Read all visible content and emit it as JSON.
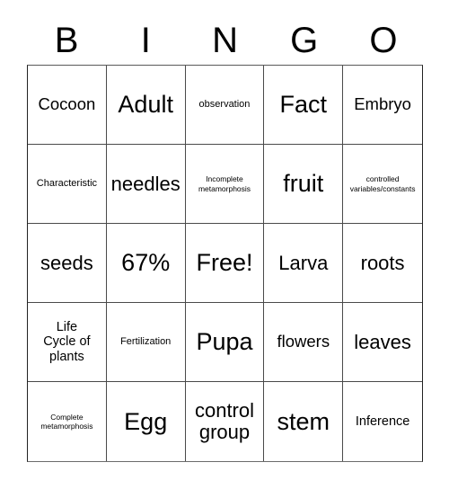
{
  "card": {
    "header_letters": [
      "B",
      "I",
      "N",
      "G",
      "O"
    ],
    "rows": [
      [
        {
          "text": "Cocoon",
          "size": "sz-lg"
        },
        {
          "text": "Adult",
          "size": "sz-xxl"
        },
        {
          "text": "observation",
          "size": "sz-sm"
        },
        {
          "text": "Fact",
          "size": "sz-xxl"
        },
        {
          "text": "Embryo",
          "size": "sz-lg"
        }
      ],
      [
        {
          "text": "Characteristic",
          "size": "sz-sm"
        },
        {
          "text": "needles",
          "size": "sz-xl"
        },
        {
          "text": "Incomplete\nmetamorphosis",
          "size": "sz-xs"
        },
        {
          "text": "fruit",
          "size": "sz-xxl"
        },
        {
          "text": "controlled\nvariables/constants",
          "size": "sz-xs"
        }
      ],
      [
        {
          "text": "seeds",
          "size": "sz-xl"
        },
        {
          "text": "67%",
          "size": "sz-xxl"
        },
        {
          "text": "Free!",
          "size": "sz-xxl"
        },
        {
          "text": "Larva",
          "size": "sz-xl"
        },
        {
          "text": "roots",
          "size": "sz-xl"
        }
      ],
      [
        {
          "text": "Life\nCycle of\nplants",
          "size": "sz-md"
        },
        {
          "text": "Fertilization",
          "size": "sz-sm"
        },
        {
          "text": "Pupa",
          "size": "sz-xxl"
        },
        {
          "text": "flowers",
          "size": "sz-lg"
        },
        {
          "text": "leaves",
          "size": "sz-xl"
        }
      ],
      [
        {
          "text": "Complete\nmetamorphosis",
          "size": "sz-xs"
        },
        {
          "text": "Egg",
          "size": "sz-xxl"
        },
        {
          "text": "control\ngroup",
          "size": "sz-xl"
        },
        {
          "text": "stem",
          "size": "sz-xxl"
        },
        {
          "text": "Inference",
          "size": "sz-md"
        }
      ]
    ]
  },
  "colors": {
    "background": "#ffffff",
    "text": "#000000",
    "grid_line": "#4a4a4a",
    "outer_border": "#222222"
  }
}
